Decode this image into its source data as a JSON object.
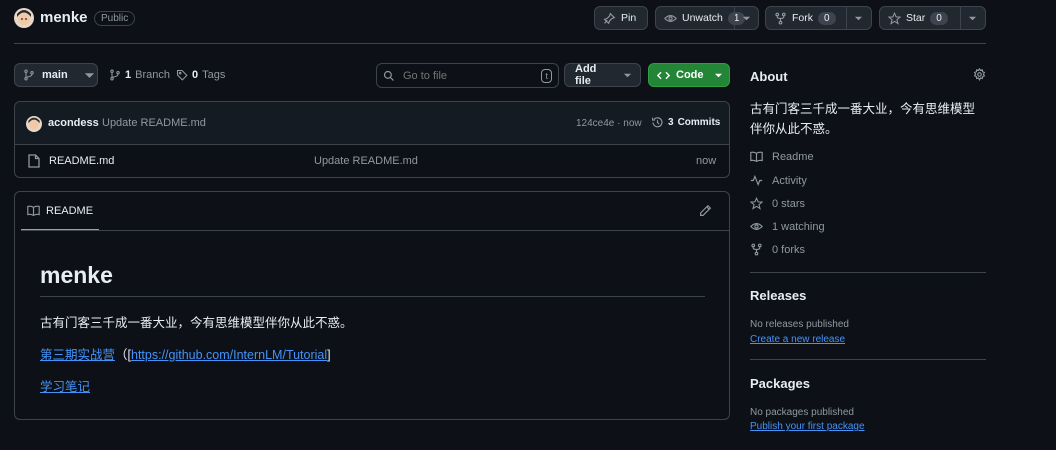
{
  "repo": {
    "name": "menke",
    "visibility": "Public"
  },
  "header": {
    "pin_label": "Pin",
    "unwatch_label": "Unwatch",
    "unwatch_count": "1",
    "fork_label": "Fork",
    "fork_count": "0",
    "star_label": "Star",
    "star_count": "0"
  },
  "toolbar": {
    "branch": "main",
    "branch_count": "1",
    "branch_word": "Branch",
    "tag_count": "0",
    "tag_word": "Tags",
    "search_placeholder": "Go to file",
    "search_shortcut": "t",
    "add_file_label": "Add file",
    "code_label": "Code"
  },
  "commit": {
    "author": "acondess",
    "message": "Update README.md",
    "hash_time": "124ce4e · now",
    "commits_count": "3",
    "commits_word": "Commits"
  },
  "files": [
    {
      "name": "README.md",
      "message": "Update README.md",
      "time": "now"
    }
  ],
  "readme": {
    "tab_label": "README",
    "title": "menke",
    "paragraph": "古有门客三千成一番大业，今有思维模型伴你从此不惑。",
    "link1_text": "第三期实战营",
    "link1_prefix": "（[",
    "link1_url": "https://github.com/InternLM/Tutorial",
    "link1_suffix": "]",
    "link2_text": "学习笔记"
  },
  "about": {
    "heading": "About",
    "description": "古有门客三千成一番大业，今有思维模型伴你从此不惑。",
    "items": [
      "Readme",
      "Activity",
      "0 stars",
      "1 watching",
      "0 forks"
    ]
  },
  "releases": {
    "heading": "Releases",
    "empty": "No releases published",
    "link": "Create a new release"
  },
  "packages": {
    "heading": "Packages",
    "empty": "No packages published",
    "link": "Publish your first package"
  },
  "colors": {
    "bg": "#0d1117",
    "border": "#3d444d",
    "link": "#4493f8",
    "code_green": "#238636",
    "accent_tab": "#f78166"
  }
}
